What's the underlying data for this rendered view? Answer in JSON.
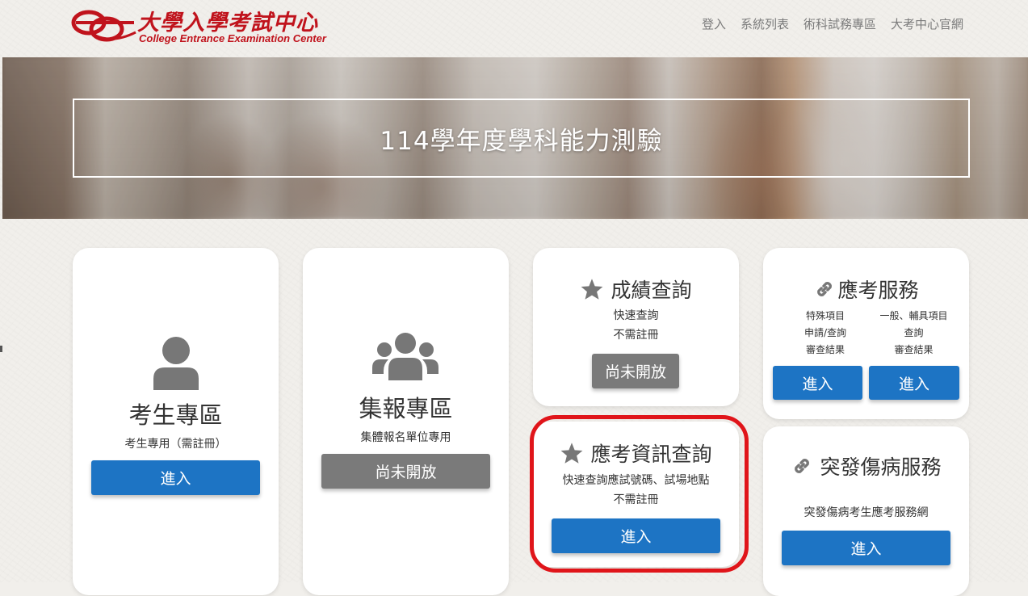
{
  "header": {
    "logo_cn": "大學入學考試中心",
    "logo_en": "College Entrance Examination Center",
    "nav": [
      "登入",
      "系統列表",
      "術科試務專區",
      "大考中心官網"
    ]
  },
  "banner": {
    "title": "114學年度學科能力測驗"
  },
  "cards": {
    "student": {
      "title": "考生專區",
      "desc": "考生專用（需註冊）",
      "button": "進入"
    },
    "group": {
      "title": "集報專區",
      "desc": "集體報名單位專用",
      "button": "尚未開放"
    },
    "score": {
      "title": "成績查詢",
      "line1": "快速查詢",
      "line2": "不需註冊",
      "button": "尚未開放"
    },
    "service": {
      "title": "應考服務",
      "left": [
        "特殊項目",
        "申請/查詢",
        "審查結果"
      ],
      "right": [
        "一般、輔具項目",
        "查詢",
        "審查結果"
      ],
      "button_left": "進入",
      "button_right": "進入"
    },
    "exam_info": {
      "title": "應考資訊查詢",
      "line1": "快速查詢應試號碼、試場地點",
      "line2": "不需註冊",
      "button": "進入"
    },
    "emergency": {
      "title": "突發傷病服務",
      "desc": "突發傷病考生應考服務網",
      "button": "進入"
    }
  },
  "colors": {
    "brand_red": "#c0131c",
    "button_blue": "#1d74c4",
    "button_gray": "#7a7a7a",
    "highlight_red": "#e0151a"
  }
}
